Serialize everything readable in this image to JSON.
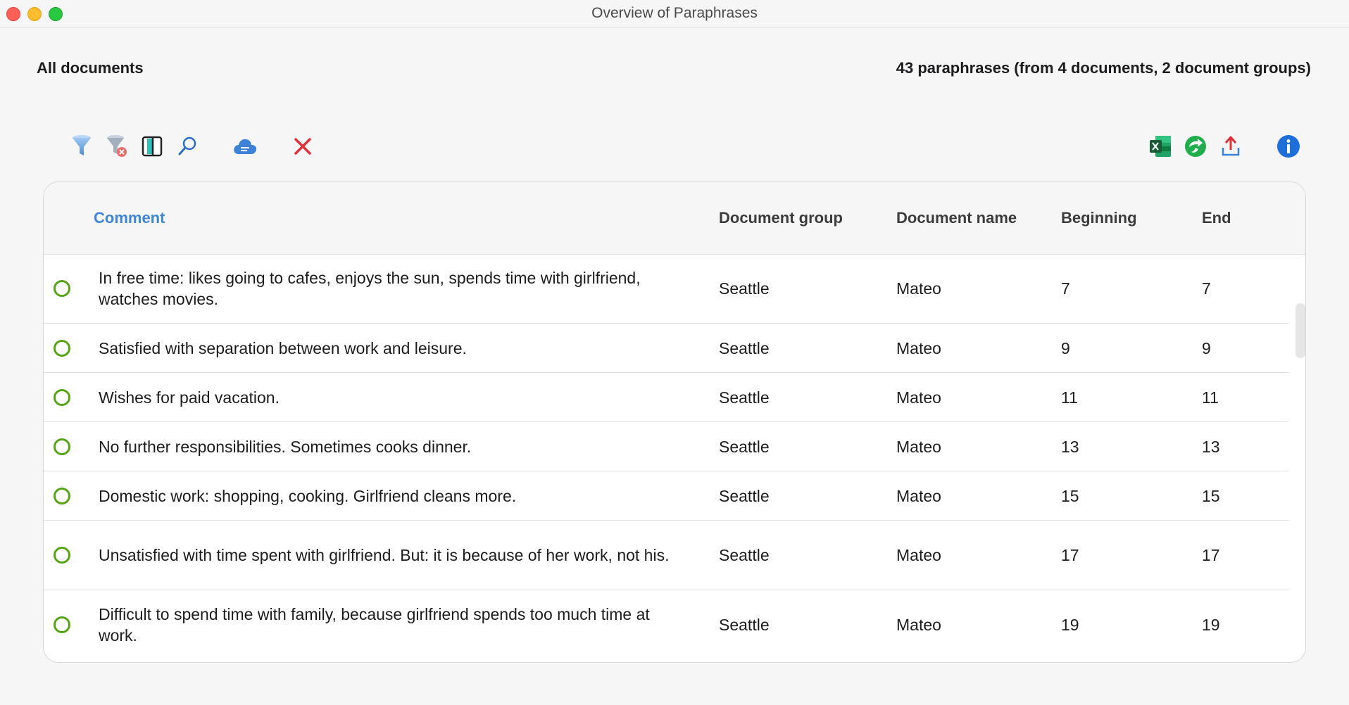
{
  "window": {
    "title": "Overview of Paraphrases"
  },
  "header": {
    "scope": "All documents",
    "summary": "43 paraphrases (from 4 documents, 2 document groups)"
  },
  "toolbar": {
    "left": [
      {
        "name": "filter-icon"
      },
      {
        "name": "remove-filter-icon"
      },
      {
        "name": "column-view-icon"
      },
      {
        "name": "search-icon"
      },
      {
        "name": "cloud-icon"
      },
      {
        "name": "delete-icon"
      }
    ],
    "right": [
      {
        "name": "excel-export-icon"
      },
      {
        "name": "smartpublisher-icon"
      },
      {
        "name": "export-icon"
      },
      {
        "name": "info-icon"
      }
    ]
  },
  "table": {
    "columns": {
      "comment": "Comment",
      "group": "Document group",
      "name": "Document name",
      "beginning": "Beginning",
      "end": "End"
    },
    "rows": [
      {
        "comment": "In free time: likes going to cafes, enjoys the sun, spends time with girlfriend, watches movies.",
        "group": "Seattle",
        "name": "Mateo",
        "beginning": "7",
        "end": "7"
      },
      {
        "comment": "Satisfied with separation between work and leisure.",
        "group": "Seattle",
        "name": "Mateo",
        "beginning": "9",
        "end": "9"
      },
      {
        "comment": "Wishes for paid vacation.",
        "group": "Seattle",
        "name": "Mateo",
        "beginning": "11",
        "end": "11"
      },
      {
        "comment": "No further responsibilities. Sometimes cooks dinner.",
        "group": "Seattle",
        "name": "Mateo",
        "beginning": "13",
        "end": "13"
      },
      {
        "comment": "Domestic work: shopping, cooking. Girlfriend cleans more.",
        "group": "Seattle",
        "name": "Mateo",
        "beginning": "15",
        "end": "15"
      },
      {
        "comment": "Unsatisfied with time spent with girlfriend. But: it is because of her work, not his.",
        "group": "Seattle",
        "name": "Mateo",
        "beginning": "17",
        "end": "17"
      },
      {
        "comment": "Difficult to spend time with family, because girlfriend spends too much time at work.",
        "group": "Seattle",
        "name": "Mateo",
        "beginning": "19",
        "end": "19"
      }
    ]
  },
  "colors": {
    "accent": "#3f86d9",
    "status": "#57a316",
    "delete": "#e0303a",
    "excel": "#1d7a45"
  }
}
